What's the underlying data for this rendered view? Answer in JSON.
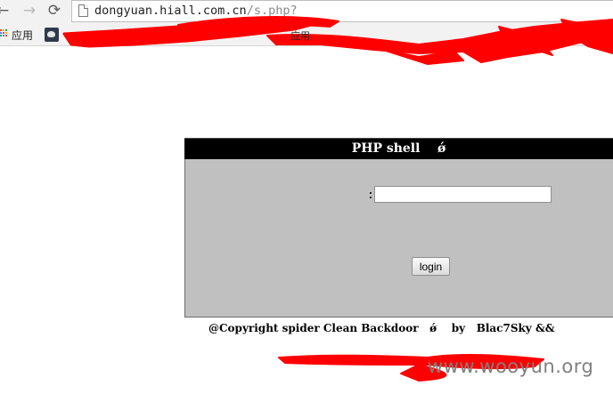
{
  "browser": {
    "back_icon": "←",
    "forward_icon": "→",
    "reload_icon": "⟳",
    "url_host": "dongyuan.hiall.com.cn",
    "url_path": "/s.php?"
  },
  "bookmarks": {
    "apps_label": "应用",
    "visible_text_1": "应用"
  },
  "panel": {
    "title": "PHP shell    ǿ",
    "password_label": ":",
    "password_value": "",
    "login_label": "login"
  },
  "footer": {
    "copyright": "@Copyright spider Clean Backdoor   ǿ    by   Blac7Sky &&"
  },
  "watermark": {
    "text": "www.wooyun.org"
  },
  "colors": {
    "redaction": "#ff0000",
    "panel_header": "#000000",
    "panel_body": "#c0c0c0"
  }
}
